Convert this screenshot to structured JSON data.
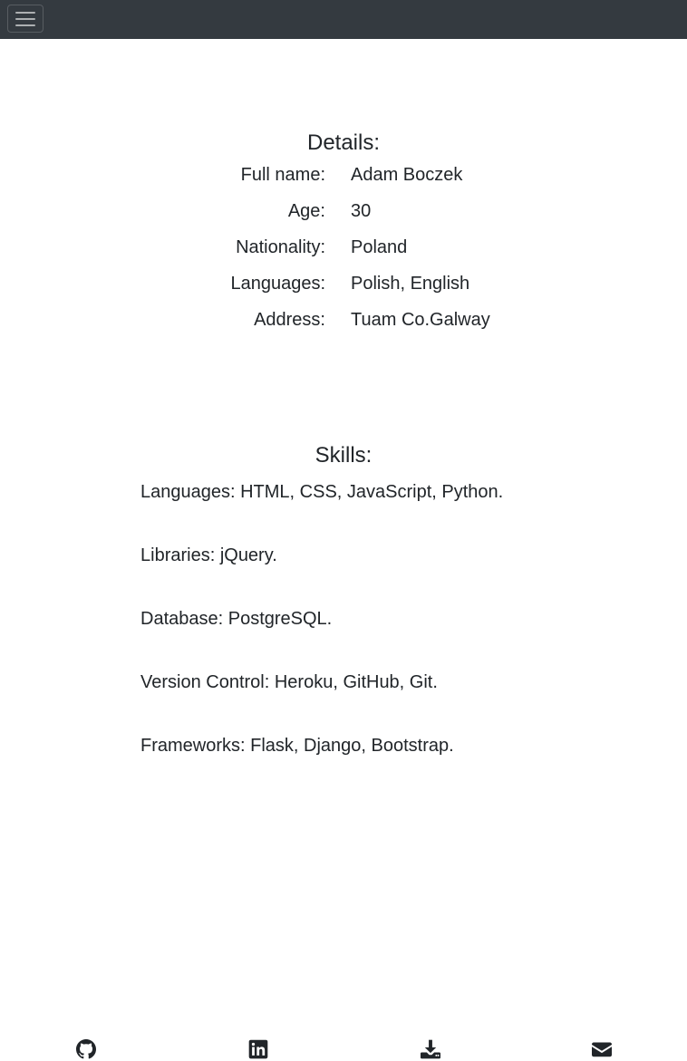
{
  "details": {
    "title": "Details:",
    "rows": [
      {
        "label": "Full name:",
        "value": "Adam Boczek"
      },
      {
        "label": "Age:",
        "value": "30"
      },
      {
        "label": "Nationality:",
        "value": "Poland"
      },
      {
        "label": "Languages:",
        "value": "Polish, English"
      },
      {
        "label": "Address:",
        "value": "Tuam Co.Galway"
      }
    ]
  },
  "skills": {
    "title": "Skills:",
    "lines": [
      "Languages: HTML, CSS, JavaScript, Python.",
      "Libraries: jQuery.",
      "Database: PostgreSQL.",
      "Version Control: Heroku, GitHub, Git.",
      "Frameworks: Flask, Django, Bootstrap."
    ]
  },
  "footer": {
    "icons": [
      "github-icon",
      "linkedin-icon",
      "download-icon",
      "envelope-icon"
    ]
  },
  "colors": {
    "navbar": "#343a40",
    "text": "#212529"
  }
}
